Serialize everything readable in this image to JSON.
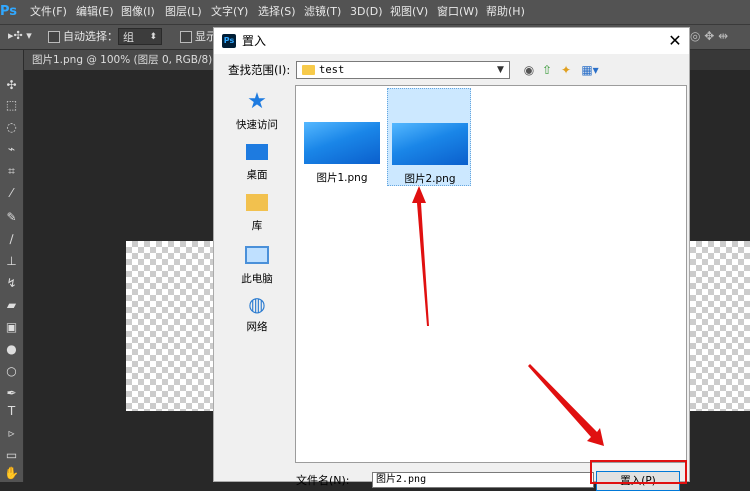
{
  "app": {
    "logo": "Ps",
    "menus": [
      "文件(F)",
      "编辑(E)",
      "图像(I)",
      "图层(L)",
      "文字(Y)",
      "选择(S)",
      "滤镜(T)",
      "3D(D)",
      "视图(V)",
      "窗口(W)",
      "帮助(H)"
    ]
  },
  "options_bar": {
    "auto_select_label": "自动选择：",
    "auto_select_value": "组",
    "show_label": "显示"
  },
  "document_tab": {
    "title": "图片1.png @ 100% (图层 0, RGB/8) *",
    "close": "×"
  },
  "dialog": {
    "title": "置入",
    "close": "✕",
    "look_in_label": "查找范围(I):",
    "look_in_value": "test",
    "places": [
      "快速访问",
      "桌面",
      "库",
      "此电脑",
      "网络"
    ],
    "files": [
      {
        "name": "图片1.png",
        "selected": false
      },
      {
        "name": "图片2.png",
        "selected": true
      }
    ],
    "filename_label": "文件名(N):",
    "filename_value": "图片2.png",
    "place_button": "置入(P)"
  },
  "colors": {
    "annotation_red": "#e01010",
    "selection_blue": "#cce8ff",
    "ps_blue": "#31a8ff"
  }
}
